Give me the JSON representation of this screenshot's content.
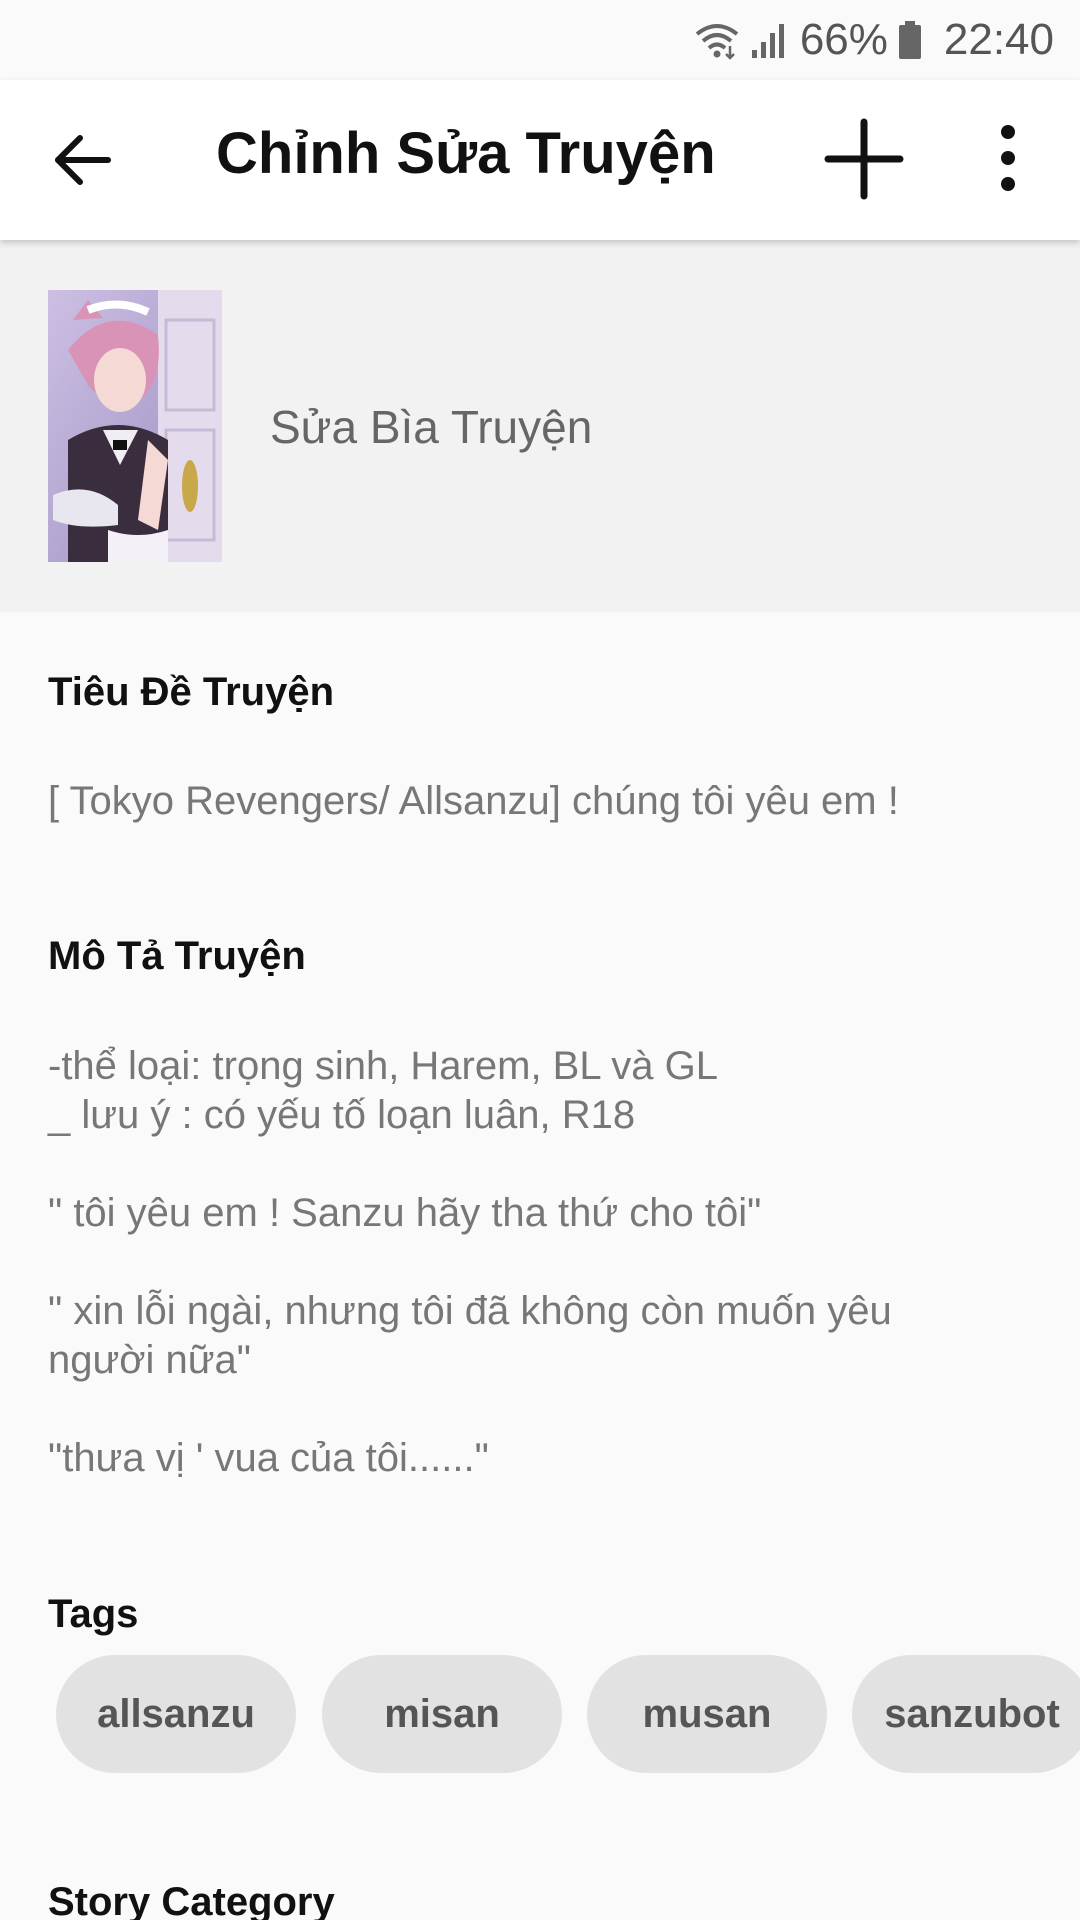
{
  "status_bar": {
    "battery": "66%",
    "time": "22:40"
  },
  "app_bar": {
    "title": "Chỉnh Sửa Truyện"
  },
  "cover": {
    "label": "Sửa Bìa Truyện"
  },
  "story_title": {
    "label": "Tiêu Đề Truyện",
    "value": "[ Tokyo Revengers/ Allsanzu] chúng tôi yêu em !"
  },
  "story_description": {
    "label": "Mô Tả Truyện",
    "lines": [
      "-thể loại: trọng sinh, Harem, BL và GL",
      "_ lưu ý : có yếu tố loạn luân, R18",
      "\" tôi yêu em ! Sanzu hãy tha thứ cho tôi\"",
      "\" xin lỗi ngài, nhưng tôi đã không còn muốn yêu",
      "người nữa\"",
      "\"thưa vị ' vua của tôi......\""
    ]
  },
  "tags": {
    "label": "Tags",
    "items": [
      "allsanzu",
      "misan",
      "musan",
      "sanzubot"
    ]
  },
  "story_category": {
    "label": "Story Category"
  }
}
